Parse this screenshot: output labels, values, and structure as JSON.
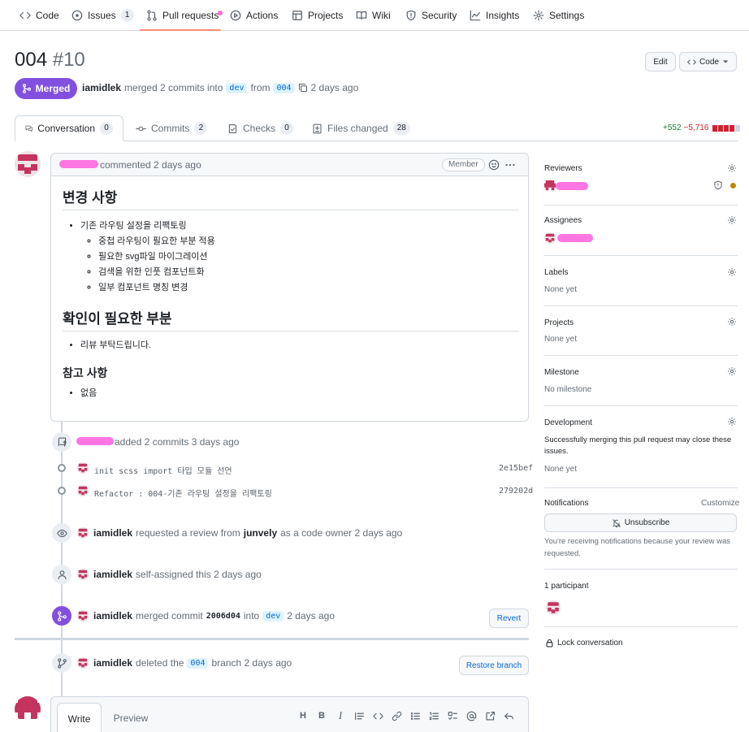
{
  "nav": {
    "code": "Code",
    "issues": "Issues",
    "issues_count": "1",
    "pull_requests": "Pull requests",
    "actions": "Actions",
    "projects": "Projects",
    "wiki": "Wiki",
    "security": "Security",
    "insights": "Insights",
    "settings": "Settings"
  },
  "header": {
    "title": "004",
    "number": "#10",
    "edit_label": "Edit",
    "code_label": "Code",
    "state": "Merged",
    "author": "iamidlek",
    "action_text": "merged 2 commits into",
    "base_branch": "dev",
    "from_text": "from",
    "head_branch": "004",
    "time": "2 days ago"
  },
  "tabs": [
    {
      "label": "Conversation",
      "count": "0"
    },
    {
      "label": "Commits",
      "count": "2"
    },
    {
      "label": "Checks",
      "count": "0"
    },
    {
      "label": "Files changed",
      "count": "28"
    }
  ],
  "diffstat": {
    "additions": "+552",
    "deletions": "−5,716"
  },
  "comment": {
    "action": "commented 2 days ago",
    "role": "Member",
    "h_changes": "변경 사항",
    "changes_main": "기존 라우팅 설정을 리팩토링",
    "changes_sub": [
      "중첩 라우팅이 필요한 부분 적용",
      "필요한 svg파일 마이그레이션",
      "검색을 위한 인풋 컴포넌트화",
      "일부 컴포넌트 명칭 변경"
    ],
    "h_review": "확인이 필요한 부분",
    "review_item": "리뷰 부탁드립니다.",
    "h_refs": "참고 사항",
    "refs_item": "없음"
  },
  "timeline": {
    "commits_event": "added 2 commits 3 days ago",
    "commits": [
      {
        "message": "init scss import 타입 모듈 선언",
        "sha": "2e15bef"
      },
      {
        "message": "Refactor : 004-기존 라우팅 설정을 리팩토링",
        "sha": "279202d"
      }
    ],
    "review_user": "iamidlek",
    "review_text": "requested a review from",
    "review_target": "junvely",
    "review_suffix": "as a code owner 2 days ago",
    "assign_user": "iamidlek",
    "assign_text": "self-assigned this 2 days ago",
    "merge_user": "iamidlek",
    "merge_text": "merged commit",
    "merge_sha": "2006d04",
    "merge_into": "into",
    "merge_branch": "dev",
    "merge_time": "2 days ago",
    "revert_label": "Revert",
    "delete_user": "iamidlek",
    "delete_text": "deleted the",
    "delete_branch": "004",
    "delete_suffix": "branch 2 days ago",
    "restore_label": "Restore branch"
  },
  "sidebar": {
    "reviewers": "Reviewers",
    "assignees": "Assignees",
    "labels": "Labels",
    "labels_val": "None yet",
    "projects": "Projects",
    "projects_val": "None yet",
    "milestone": "Milestone",
    "milestone_val": "No milestone",
    "development": "Development",
    "development_desc": "Successfully merging this pull request may close these issues.",
    "development_val": "None yet",
    "notifications": "Notifications",
    "customize": "Customize",
    "unsubscribe": "Unsubscribe",
    "notif_desc": "You're receiving notifications because your review was requested.",
    "participants": "1 participant",
    "lock": "Lock conversation"
  },
  "editor": {
    "write": "Write",
    "preview": "Preview"
  },
  "colors": {
    "merged": "#8250df",
    "additions": "#1a7f37",
    "deletions": "#cf222e",
    "avatar": "#c4345f"
  }
}
